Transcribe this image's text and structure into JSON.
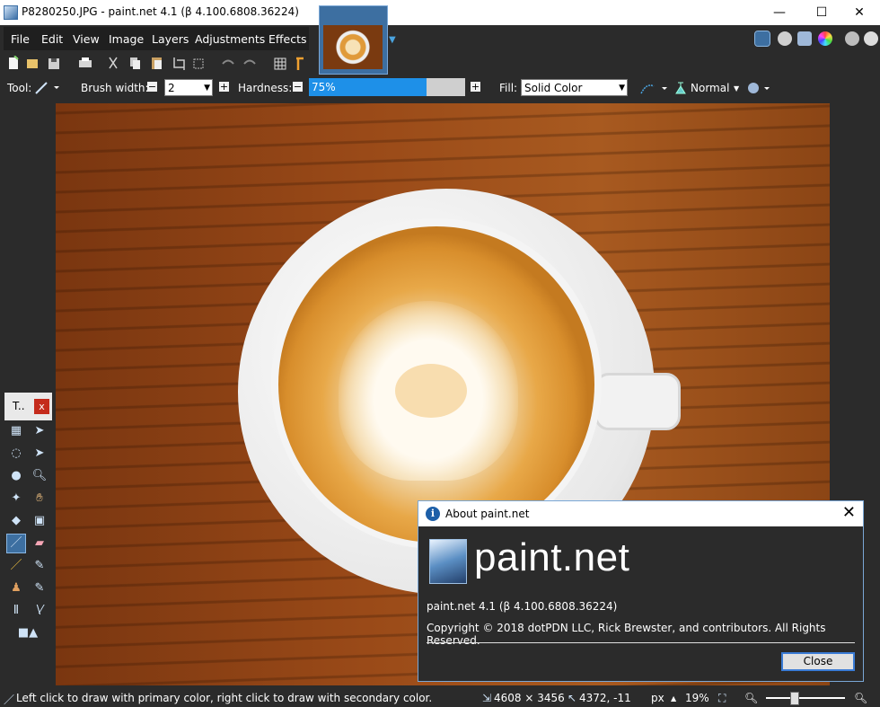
{
  "window": {
    "title": "P8280250.JPG - paint.net 4.1 (β 4.100.6808.36224)",
    "minimize": "—",
    "maximize": "☐",
    "close": "✕"
  },
  "menu": {
    "items": [
      "File",
      "Edit",
      "View",
      "Image",
      "Layers",
      "Adjustments",
      "Effects"
    ]
  },
  "options": {
    "tool_label": "Tool:",
    "brush_width_label": "Brush width:",
    "brush_width_value": "2",
    "hardness_label": "Hardness:",
    "hardness_value": "75%",
    "hardness_fraction": 0.75,
    "fill_label": "Fill:",
    "fill_value": "Solid Color",
    "blend_mode": "Normal"
  },
  "tools_panel": {
    "title": "T..",
    "close": "x"
  },
  "status": {
    "hint": "Left click to draw with primary color, right click to draw with secondary color.",
    "image_size": "4608 × 3456",
    "cursor_pos": "4372, -11",
    "units": "px",
    "zoom": "19%"
  },
  "about": {
    "title": "About paint.net",
    "brand": "paint.net",
    "version": "paint.net 4.1 (β 4.100.6808.36224)",
    "copyright": "Copyright © 2018 dotPDN LLC, Rick Brewster, and contributors. All Rights Reserved.",
    "close_button": "Close"
  },
  "colors": {
    "accent": "#1e90e8",
    "panel_bg": "#2b2b2b",
    "close_red": "#c42b1c"
  }
}
